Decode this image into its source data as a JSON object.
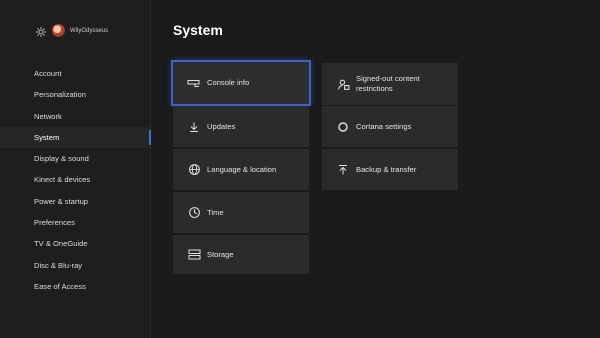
{
  "profile": {
    "gamertag": "WilyOdysseus"
  },
  "page_title": "System",
  "nav": [
    {
      "label": "Account"
    },
    {
      "label": "Personalization"
    },
    {
      "label": "Network"
    },
    {
      "label": "System",
      "active": true
    },
    {
      "label": "Display & sound"
    },
    {
      "label": "Kinect & devices"
    },
    {
      "label": "Power & startup"
    },
    {
      "label": "Preferences"
    },
    {
      "label": "TV & OneGuide"
    },
    {
      "label": "Disc & Blu-ray"
    },
    {
      "label": "Ease of Access"
    }
  ],
  "tiles_left": [
    {
      "label": "Console info",
      "icon": "console-icon",
      "focused": true
    },
    {
      "label": "Updates",
      "icon": "download-icon"
    },
    {
      "label": "Language & location",
      "icon": "globe-icon"
    },
    {
      "label": "Time",
      "icon": "clock-icon"
    },
    {
      "label": "Storage",
      "icon": "storage-icon"
    }
  ],
  "tiles_right": [
    {
      "label": "Signed-out content restrictions",
      "icon": "restricted-user-icon"
    },
    {
      "label": "Cortana settings",
      "icon": "cortana-icon"
    },
    {
      "label": "Backup & transfer",
      "icon": "upload-icon"
    }
  ],
  "colors": {
    "focus": "#3b63d0",
    "background": "#1b1b1b",
    "tile": "#2b2b2b"
  }
}
